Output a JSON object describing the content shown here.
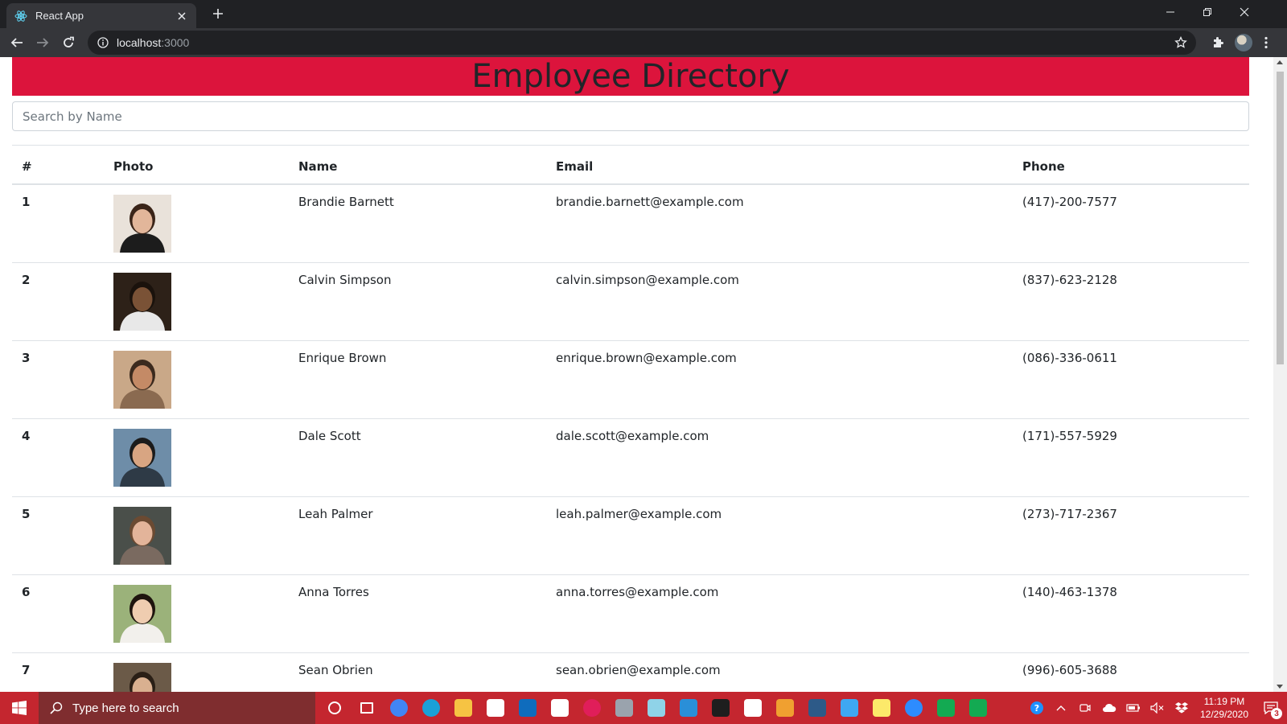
{
  "browser": {
    "tab_title": "React App",
    "url_host": "localhost",
    "url_port": ":3000"
  },
  "app": {
    "title": "Employee Directory",
    "search_placeholder": "Search by Name",
    "accent_color": "#dc143c"
  },
  "table": {
    "headers": [
      "#",
      "Photo",
      "Name",
      "Email",
      "Phone"
    ],
    "rows": [
      {
        "num": "1",
        "name": "Brandie Barnett",
        "email": "brandie.barnett@example.com",
        "phone": "(417)-200-7577",
        "photo": {
          "bg": "#e9e2da",
          "skin": "#e2b69a",
          "hair": "#3a2418",
          "shirt": "#1c1c1c"
        }
      },
      {
        "num": "2",
        "name": "Calvin Simpson",
        "email": "calvin.simpson@example.com",
        "phone": "(837)-623-2128",
        "photo": {
          "bg": "#2d2118",
          "skin": "#7a5236",
          "hair": "#1a120c",
          "shirt": "#e8e8e8"
        }
      },
      {
        "num": "3",
        "name": "Enrique Brown",
        "email": "enrique.brown@example.com",
        "phone": "(086)-336-0611",
        "photo": {
          "bg": "#c9a888",
          "skin": "#c48a66",
          "hair": "#3b2a1e",
          "shirt": "#8a6a50"
        }
      },
      {
        "num": "4",
        "name": "Dale Scott",
        "email": "dale.scott@example.com",
        "phone": "(171)-557-5929",
        "photo": {
          "bg": "#6e8da8",
          "skin": "#d8a582",
          "hair": "#1b1b1b",
          "shirt": "#2e3a46"
        }
      },
      {
        "num": "5",
        "name": "Leah Palmer",
        "email": "leah.palmer@example.com",
        "phone": "(273)-717-2367",
        "photo": {
          "bg": "#4a4f4a",
          "skin": "#e3b49a",
          "hair": "#6b4a32",
          "shirt": "#7a6a60"
        }
      },
      {
        "num": "6",
        "name": "Anna Torres",
        "email": "anna.torres@example.com",
        "phone": "(140)-463-1378",
        "photo": {
          "bg": "#9bb27a",
          "skin": "#efcdb0",
          "hair": "#1e140e",
          "shirt": "#f2f0ec"
        }
      },
      {
        "num": "7",
        "name": "Sean Obrien",
        "email": "sean.obrien@example.com",
        "phone": "(996)-605-3688",
        "photo": {
          "bg": "#6b5a48",
          "skin": "#d9b090",
          "hair": "#2a1f16",
          "shirt": "#e6e6e6"
        }
      }
    ]
  },
  "taskbar": {
    "search_placeholder": "Type here to search",
    "time": "11:19 PM",
    "date": "12/29/2020",
    "notification_count": "3",
    "apps": [
      {
        "name": "cortana-icon",
        "color": "#ffffff"
      },
      {
        "name": "task-view-icon",
        "color": "#ffffff"
      },
      {
        "name": "chrome-icon",
        "color": "#4285f4"
      },
      {
        "name": "edge-icon",
        "color": "#1ba0d7"
      },
      {
        "name": "file-explorer-icon",
        "color": "#f6c343"
      },
      {
        "name": "store-icon",
        "color": "#ffffff"
      },
      {
        "name": "mail-icon",
        "color": "#0f6cbd"
      },
      {
        "name": "amazon-icon",
        "color": "#ffffff"
      },
      {
        "name": "slack-icon",
        "color": "#e01e5a"
      },
      {
        "name": "camera-icon",
        "color": "#9aa3ad"
      },
      {
        "name": "surface-icon",
        "color": "#8fd3e8"
      },
      {
        "name": "vscode-icon",
        "color": "#2a8fd8"
      },
      {
        "name": "terminal-icon",
        "color": "#1e1e1e"
      },
      {
        "name": "reader-icon",
        "color": "#ffffff"
      },
      {
        "name": "git-icon",
        "color": "#f0a030"
      },
      {
        "name": "mysql-icon",
        "color": "#2d5a88"
      },
      {
        "name": "onedrive-icon",
        "color": "#3ea8f2"
      },
      {
        "name": "sticky-notes-icon",
        "color": "#fce96a"
      },
      {
        "name": "zoom-icon",
        "color": "#2d8cff"
      },
      {
        "name": "mongodb-compass-icon",
        "color": "#13aa52"
      },
      {
        "name": "mongodb-icon",
        "color": "#13aa52"
      }
    ]
  }
}
